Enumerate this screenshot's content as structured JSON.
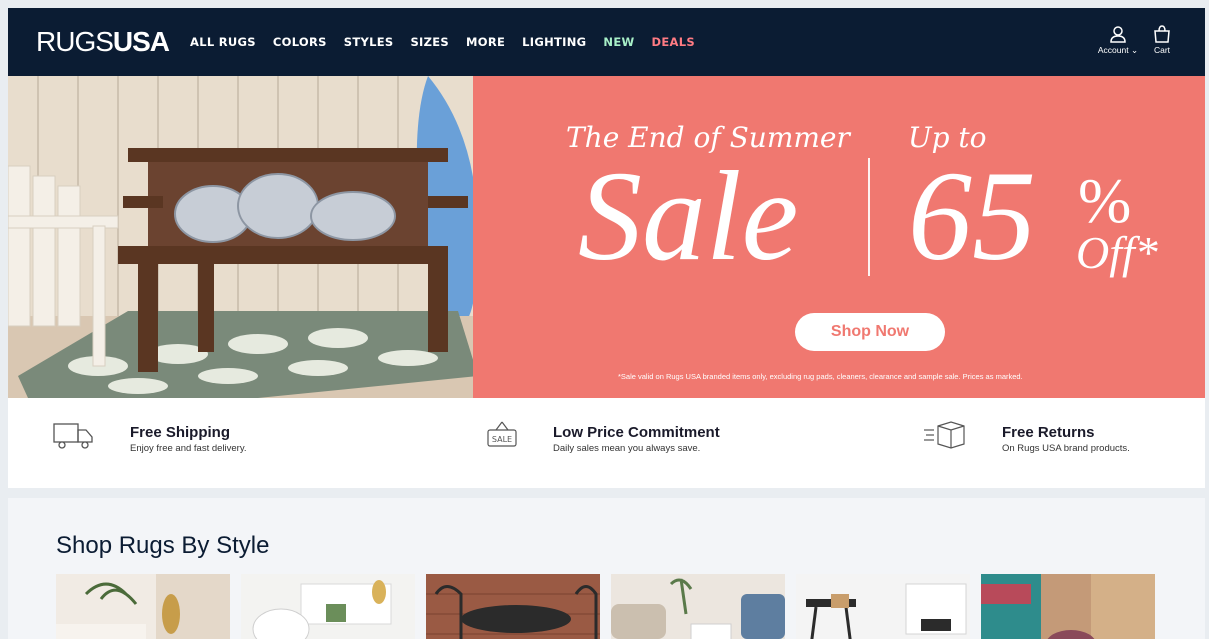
{
  "header": {
    "logo_part1": "RUGS",
    "logo_part2": "USA",
    "nav": [
      {
        "label": "ALL RUGS"
      },
      {
        "label": "COLORS"
      },
      {
        "label": "STYLES"
      },
      {
        "label": "SIZES"
      },
      {
        "label": "MORE"
      },
      {
        "label": "LIGHTING"
      },
      {
        "label": "NEW"
      },
      {
        "label": "DEALS"
      }
    ],
    "account_label": "Account",
    "cart_label": "Cart"
  },
  "hero": {
    "line1": "The End of Summer",
    "sale": "Sale",
    "upto": "Up to",
    "percent": "65",
    "percent_sign": "%",
    "off": "Off*",
    "cta": "Shop Now",
    "fineprint": "*Sale valid on Rugs USA branded items only, excluding rug pads, cleaners, clearance and sample sale. Prices as marked."
  },
  "features": [
    {
      "title": "Free Shipping",
      "subtitle": "Enjoy free and fast delivery.",
      "icon": "truck-icon"
    },
    {
      "title": "Low Price Commitment",
      "subtitle": "Daily sales mean you always save.",
      "icon": "sale-sign-icon"
    },
    {
      "title": "Free Returns",
      "subtitle": "On Rugs USA brand products.",
      "icon": "return-box-icon"
    }
  ],
  "styles_section": {
    "title": "Shop Rugs By Style"
  },
  "colors": {
    "header_bg": "#0b1c33",
    "hero_bg": "#f07870",
    "new": "#a8f0c8",
    "deals": "#ff7b83"
  }
}
